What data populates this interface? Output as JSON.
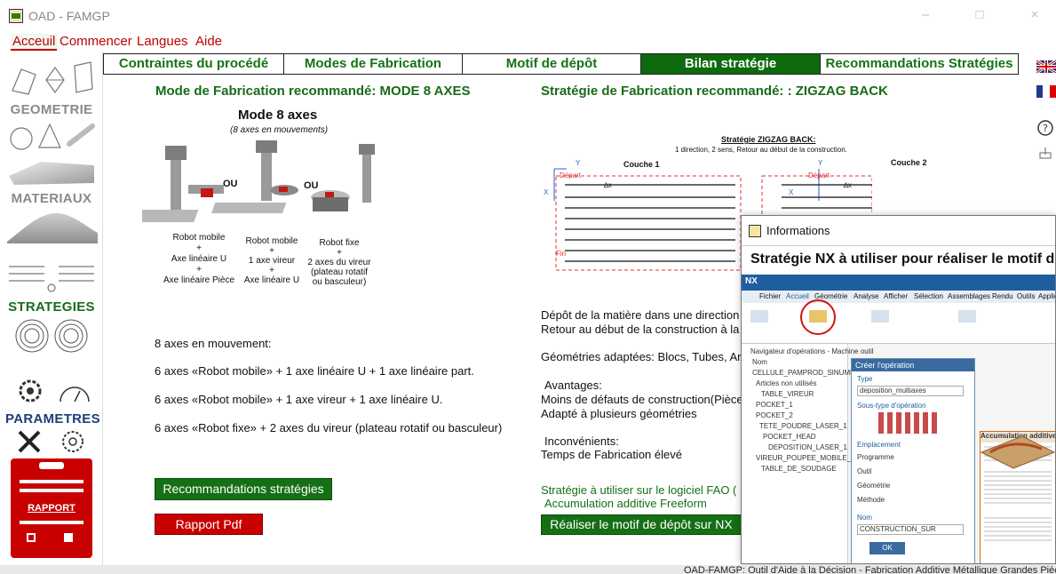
{
  "window": {
    "title": "OAD - FAMGP",
    "controls": {
      "minimize": "–",
      "maximize": "□",
      "close": "×"
    }
  },
  "menu": [
    "Acceuil",
    "Commencer",
    "Langues",
    "Aide"
  ],
  "sidebar": {
    "geometrie": "GEOMETRIE",
    "materiaux": "MATERIAUX",
    "strategies": "STRATEGIES",
    "parametres": "PARAMETRES",
    "rapport": "RAPPORT"
  },
  "tabs": [
    "Contraintes du procédé",
    "Modes de Fabrication",
    "Motif de dépôt",
    "Bilan stratégie",
    "Recommandations Stratégies"
  ],
  "left": {
    "heading": "Mode de Fabrication recommandé: MODE 8 AXES",
    "mode_title": "Mode 8 axes",
    "mode_subtitle": "(8 axes en mouvements)",
    "ou1": "OU",
    "ou2": "OU",
    "robot1": [
      "Robot mobile",
      "+",
      "Axe linéaire U",
      "+",
      "Axe linéaire Pièce"
    ],
    "robot2": [
      "Robot mobile",
      "+",
      "1 axe vireur",
      "+",
      "Axe linéaire U"
    ],
    "robot3": [
      "Robot fixe",
      "+",
      "2 axes du vireur",
      "(plateau rotatif",
      "ou basculeur)"
    ],
    "line1": "8 axes en mouvement:",
    "line2": "6 axes «Robot mobile» + 1 axe linéaire U + 1 axe linéaire part.",
    "line3": "6 axes «Robot mobile» + 1 axe vireur + 1 axe linéaire U.",
    "line4": "6 axes «Robot fixe» + 2 axes du vireur (plateau rotatif ou basculeur)",
    "btn_reco": "Recommandations stratégies",
    "btn_pdf": "Rapport Pdf"
  },
  "right": {
    "heading": "Stratégie de Fabrication recommandé: : ZIGZAG BACK",
    "diagram_title": "Stratégie ZIGZAG BACK:",
    "diagram_subtitle": "1 direction, 2 sens, Retour au début de la construction.",
    "couche1": "Couche 1",
    "couche2": "Couche 2",
    "depart": "Départ",
    "fin": "Fin",
    "dx": "∆x",
    "axis_x": "X",
    "axis_y": "Y",
    "desc1": "Dépôt de la matière dans une direction",
    "desc2": "Retour au début de la construction à la",
    "desc3": "Géométries adaptées: Blocs, Tubes, Ar",
    "adv_title": "Avantages:",
    "adv1": "Moins de défauts de construction(Pièce",
    "adv2": "Adapté à plusieurs géométries",
    "inc_title": "Inconvénients:",
    "inc1": "Temps de Fabrication élevé",
    "logiciel1": "Stratégie à utiliser sur le logiciel FAO (",
    "logiciel2": "Accumulation additive Freeform",
    "btn_nx": "Réaliser le motif de dépôt sur NX"
  },
  "modal": {
    "title": "Informations",
    "heading": "Stratégie NX à utiliser pour réaliser le motif de",
    "nx_menu": [
      "Fichier",
      "Accueil",
      "Géométrie",
      "Analyse",
      "Afficher",
      "Sélection",
      "Assemblages",
      "Rendu",
      "Outils",
      "Applica"
    ],
    "nav_items": [
      "Navigateur d'opérations - Machine outil",
      "Nom",
      "CELLULE_PAMPROD_SINUMERIK",
      "Articles non utilisés",
      "TABLE_VIREUR",
      "POCKET_1",
      "POCKET_2",
      "TETE_POUDRE_LASER_1",
      "POCKET_HEAD",
      "DEPOSITION_LASER_1",
      "VIREUR_POUPEE_MOBILE_MO...",
      "TABLE_DE_SOUDAGE"
    ],
    "dialog_title": "Créer l'opération",
    "dialog_type": "Type",
    "dialog_type_value": "deposition_multiaxes",
    "dialog_subtype": "Sous-type d'opération",
    "dialog_emplacement": "Emplacement",
    "dialog_fields": [
      "Programme",
      "Outil",
      "Géométrie",
      "Méthode"
    ],
    "dialog_nom": "Nom",
    "dialog_nom_value": "CONSTRUCTION_SUR",
    "dialog_ok": "OK",
    "callout_title": "Accumulation additive Freeform",
    "status": "OAD-FAMGP: Outil d'Aide à la Décision - Fabrication Additive Métallique Grandes Pièces"
  },
  "colors": {
    "green": "#156f15",
    "red": "#c80000",
    "blue": "#1c3f78",
    "tab_active": "#0d6b0d"
  }
}
